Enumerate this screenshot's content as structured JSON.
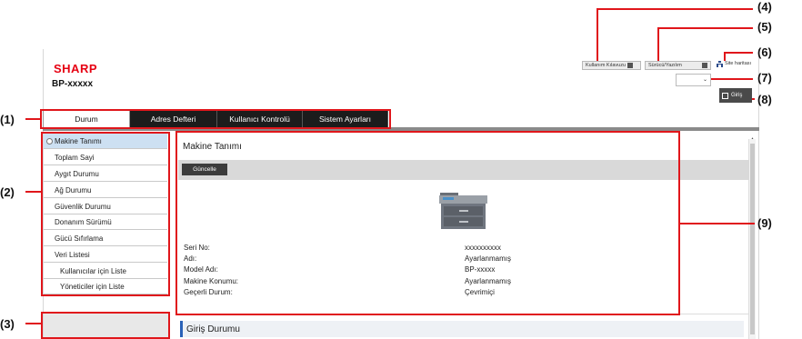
{
  "header": {
    "brand": "SHARP",
    "model": "BP-xxxxx",
    "manual_button": "Kullanım Kılavuzu",
    "driver_button": "Sürücü/Yazılım",
    "sitemap_link": "Site haritası",
    "login_button": "Giriş",
    "language_select": {
      "value": ""
    }
  },
  "tabs": [
    {
      "label": "Durum",
      "active": true
    },
    {
      "label": "Adres Defteri",
      "active": false
    },
    {
      "label": "Kullanıcı Kontrolü",
      "active": false
    },
    {
      "label": "Sistem Ayarları",
      "active": false
    }
  ],
  "sidebar": {
    "items": [
      {
        "label": "Makine Tanımı",
        "active": true
      },
      {
        "label": "Toplam Sayi"
      },
      {
        "label": "Aygıt Durumu"
      },
      {
        "label": "Ağ Durumu"
      },
      {
        "label": "Güvenlik Durumu"
      },
      {
        "label": "Donanım Sürümü"
      },
      {
        "label": "Gücü Sıfırlama"
      },
      {
        "label": "Veri Listesi"
      },
      {
        "label": "Kullanıcılar için Liste",
        "sub": true
      },
      {
        "label": "Yöneticiler için Liste",
        "sub": true
      }
    ]
  },
  "main": {
    "title": "Makine Tanımı",
    "refresh_button": "Güncelle",
    "info": [
      {
        "label": "Seri No:",
        "value": "xxxxxxxxxx"
      },
      {
        "label": "Adı:",
        "value": "Ayarlanmamış"
      },
      {
        "label": "Model Adı:",
        "value": "BP-xxxxx"
      },
      {
        "label": "Makine Konumu:",
        "value": "Ayarlanmamış"
      },
      {
        "label": "Geçerli Durum:",
        "value": "Çevrimiçi"
      }
    ],
    "section_title": "Giriş Durumu"
  },
  "callouts": [
    "(1)",
    "(2)",
    "(3)",
    "(4)",
    "(5)",
    "(6)",
    "(7)",
    "(8)",
    "(9)"
  ],
  "colors": {
    "brand_red": "#e60012",
    "callout_red": "#e0161b",
    "tab_dark": "#1c1c1c",
    "sidebar_active": "#cde0f2",
    "section_accent": "#2a62b8"
  }
}
